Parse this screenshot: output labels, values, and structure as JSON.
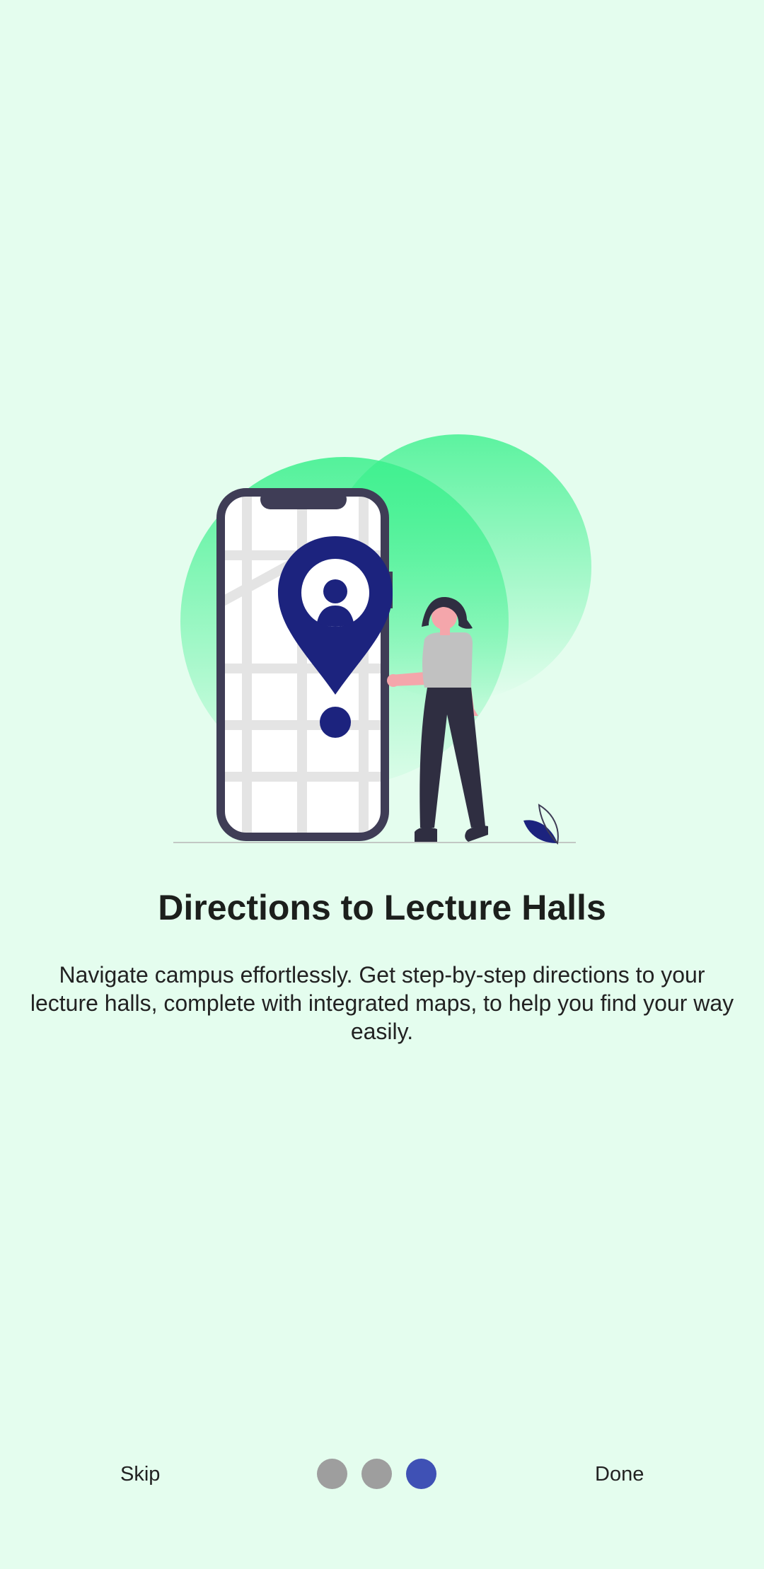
{
  "onboarding": {
    "title": "Directions to Lecture Halls",
    "description": "Navigate campus effortlessly. Get step-by-step directions to your lecture halls, complete with integrated maps, to help you find your way easily.",
    "illustration_icon": "phone-map-location-pin-person-icon"
  },
  "navigation": {
    "skip_label": "Skip",
    "done_label": "Done",
    "page_count": 3,
    "current_page": 3
  },
  "colors": {
    "background": "#e4fdee",
    "accent": "#3f51b5",
    "dot_inactive": "#9e9e9e",
    "pin": "#1c237e",
    "blob": "#3af08c"
  }
}
